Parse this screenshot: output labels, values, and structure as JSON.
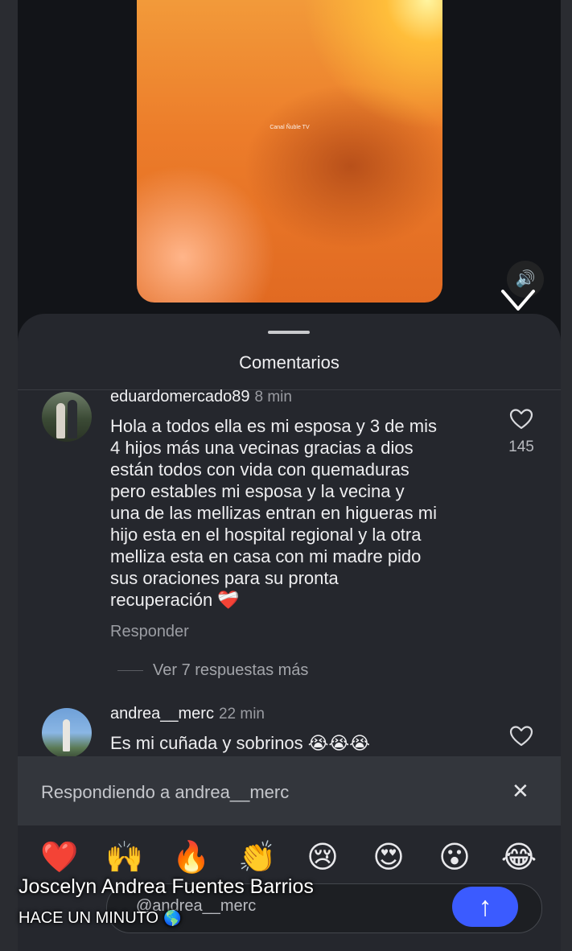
{
  "video": {
    "watermark": "Canal Ñuble TV"
  },
  "comments_sheet": {
    "title": "Comentarios",
    "comments": [
      {
        "username": "eduardomercado89",
        "time": "8 min",
        "text_lines": [
          "Hola a todos ella es mi esposa y 3 de mis",
          "4 hijos más una vecinas gracias a dios",
          "están todos con vida con quemaduras",
          "pero estables mi esposa y la vecina y",
          "una de las mellizas entran en higueras mi",
          "hijo esta en el hospital regional y la otra",
          "melliza esta en casa con mi madre pido",
          "sus oraciones para su pronta",
          "recuperación ❤️‍🩹"
        ],
        "reply_label": "Responder",
        "like_count": "145",
        "more_replies": "Ver 7 respuestas más"
      },
      {
        "username": "andrea__merc",
        "time": "22 min",
        "text": "Es mi cuñada y sobrinos 😭😭😭"
      }
    ]
  },
  "reply_bar": {
    "replying_to": "Respondiendo a andrea__merc",
    "close_icon": "✕"
  },
  "emoji_bar": {
    "emojis": [
      "❤️",
      "🙌",
      "🔥",
      "👏",
      "😢",
      "😍",
      "😮",
      "😂"
    ]
  },
  "input": {
    "value": "@andrea__merc",
    "send_icon": "↑"
  },
  "overlay": {
    "name": "Joscelyn Andrea Fuentes Barrios",
    "time": "HACE UN MINUTO",
    "globe_icon": "🌎"
  }
}
